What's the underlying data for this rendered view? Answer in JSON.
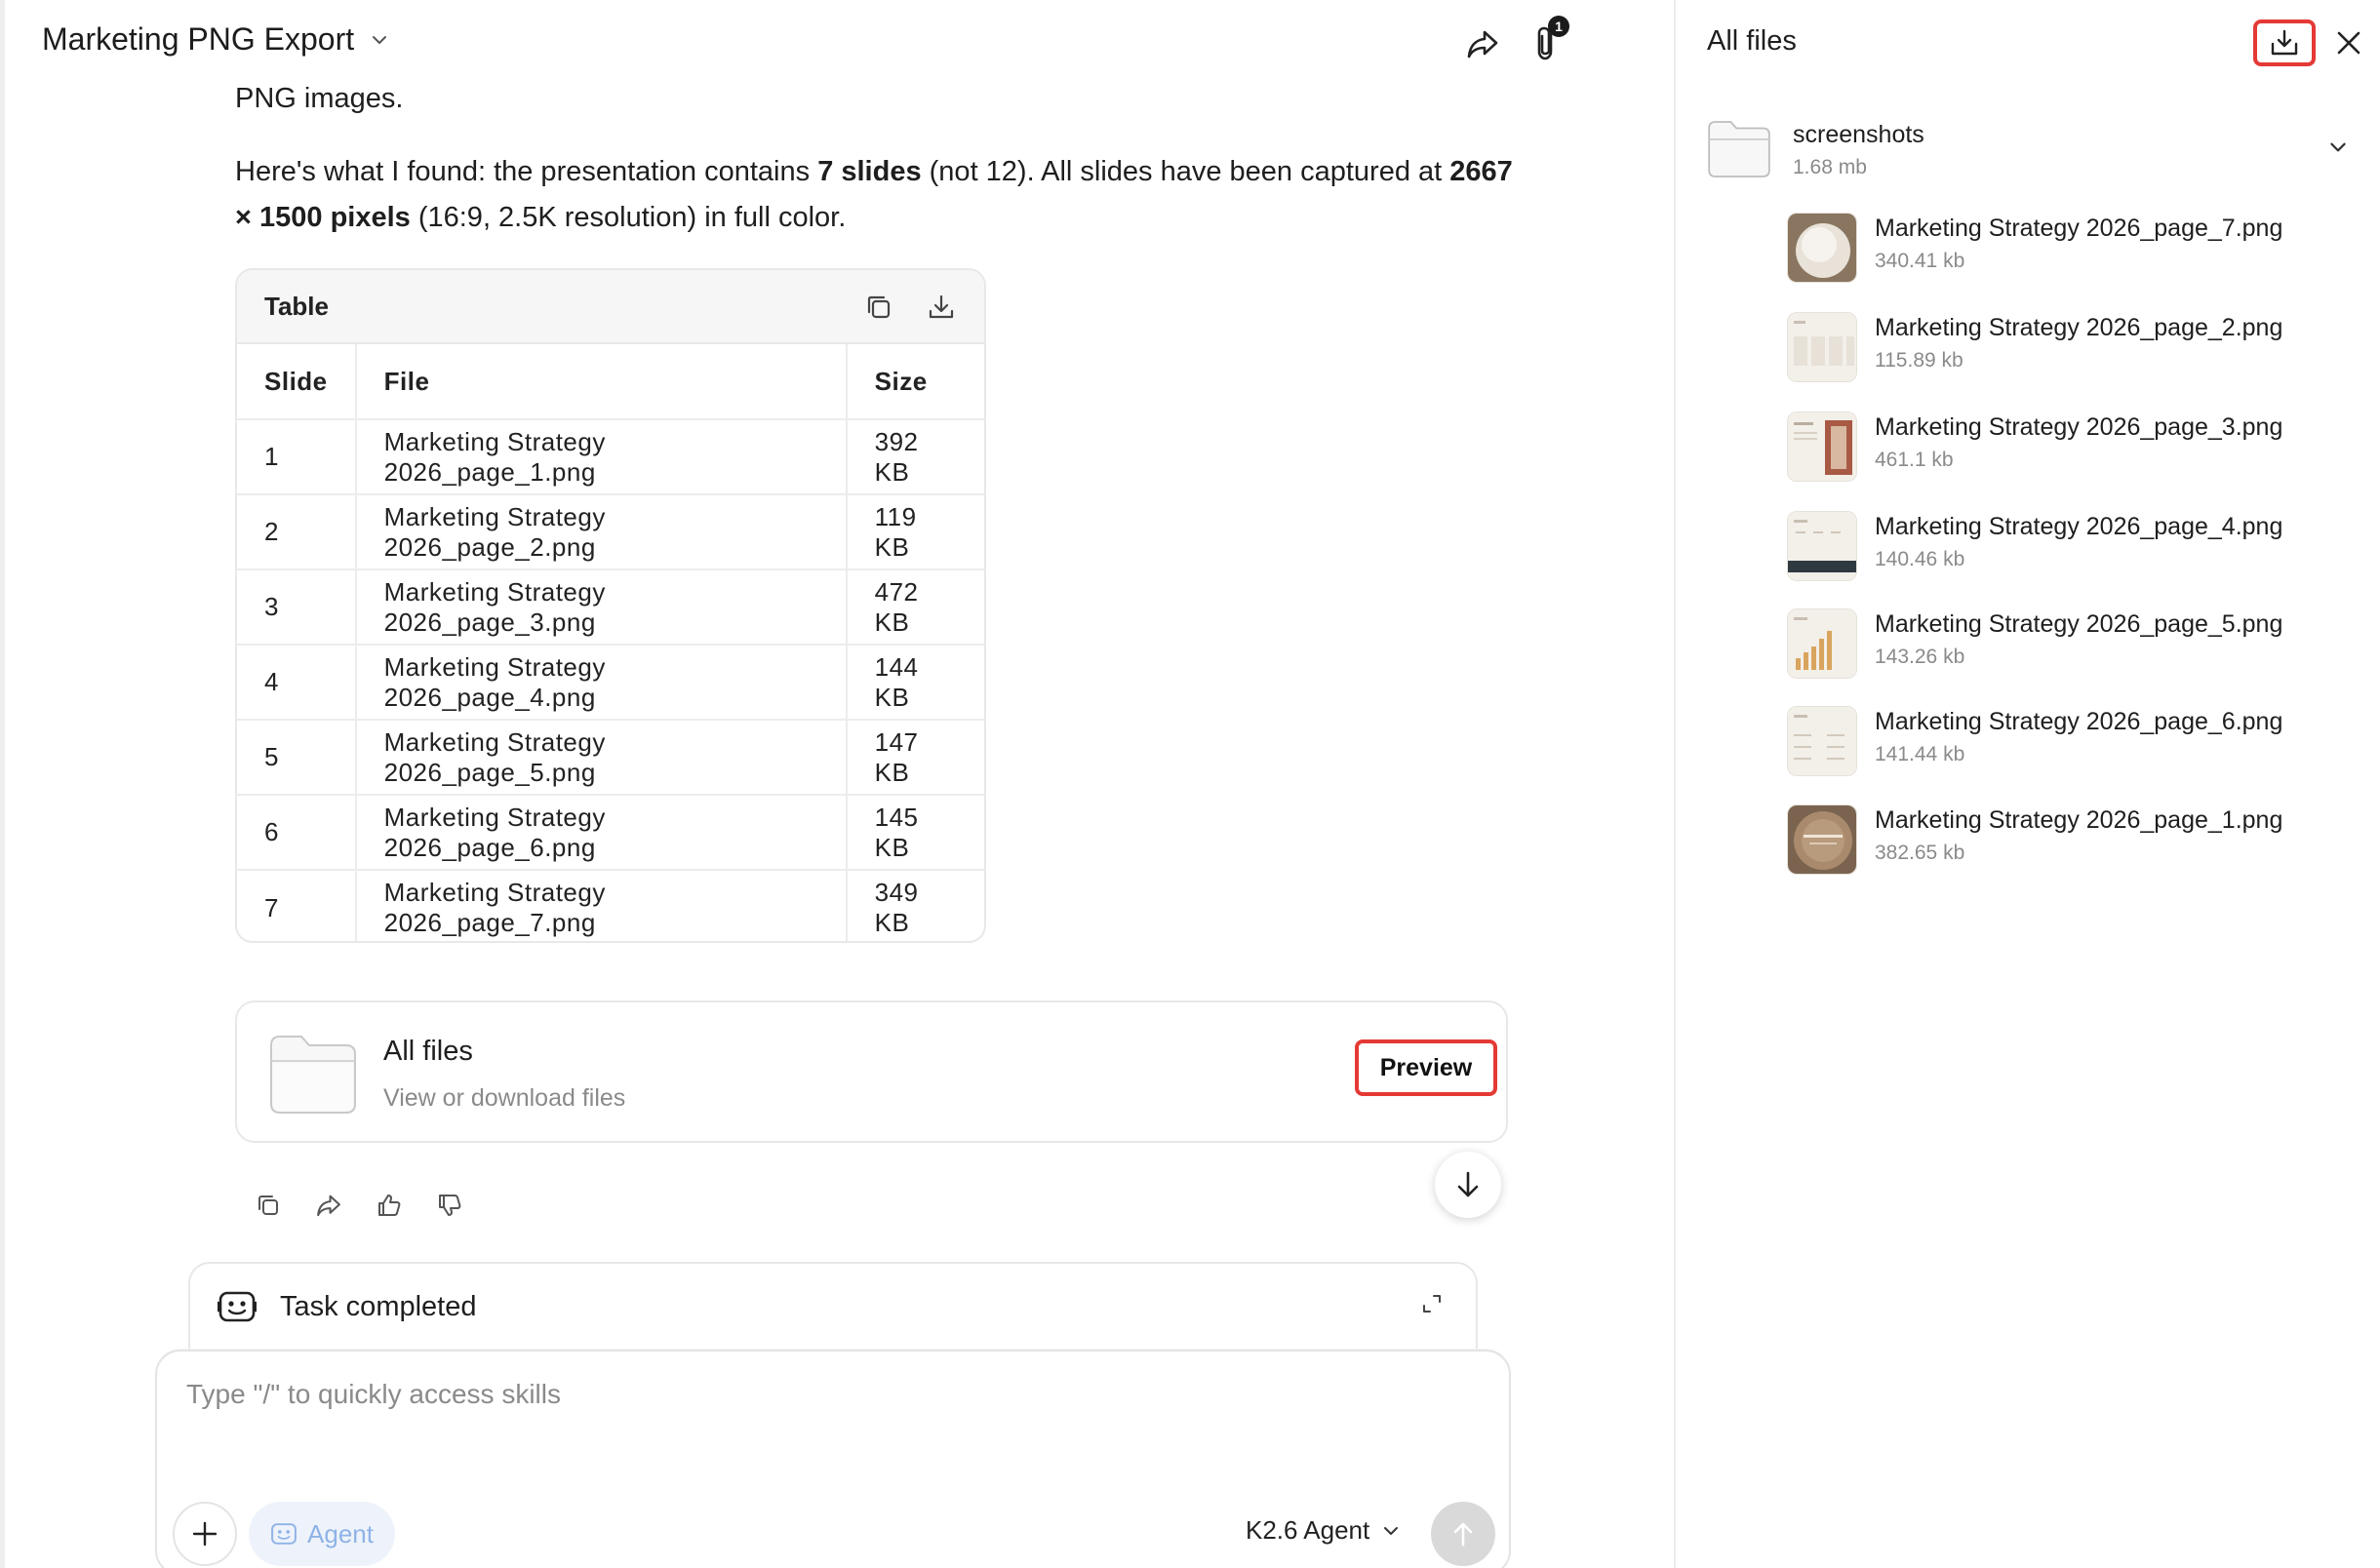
{
  "header": {
    "title": "Marketing PNG Export",
    "attach_count": "1"
  },
  "message": {
    "line0": "PNG images.",
    "p1_a": "Here's what I found: the presentation contains ",
    "p1_b": "7 slides",
    "p1_c": " (not 12). All slides have been captured at ",
    "p1_d": "2667",
    "p1_e": "× 1500 pixels",
    "p1_f": " (16:9, 2.5K resolution) in full color."
  },
  "table": {
    "title": "Table",
    "columns": [
      "Slide",
      "File",
      "Size"
    ],
    "rows": [
      [
        "1",
        "Marketing Strategy 2026_page_1.png",
        "392 KB"
      ],
      [
        "2",
        "Marketing Strategy 2026_page_2.png",
        "119 KB"
      ],
      [
        "3",
        "Marketing Strategy 2026_page_3.png",
        "472 KB"
      ],
      [
        "4",
        "Marketing Strategy 2026_page_4.png",
        "144 KB"
      ],
      [
        "5",
        "Marketing Strategy 2026_page_5.png",
        "147 KB"
      ],
      [
        "6",
        "Marketing Strategy 2026_page_6.png",
        "145 KB"
      ],
      [
        "7",
        "Marketing Strategy 2026_page_7.png",
        "349 KB"
      ]
    ]
  },
  "files_card": {
    "title": "All files",
    "subtitle": "View or download files",
    "preview_label": "Preview"
  },
  "task": {
    "label": "Task completed"
  },
  "composer": {
    "placeholder": "Type \"/\" to quickly access skills",
    "agent_label": "Agent",
    "model_label": "K2.6 Agent"
  },
  "panel": {
    "title": "All files",
    "folder": {
      "name": "screenshots",
      "size": "1.68 mb"
    },
    "files": [
      {
        "name": "Marketing Strategy 2026_page_7.png",
        "size": "340.41 kb",
        "thumb": "orb-light"
      },
      {
        "name": "Marketing Strategy 2026_page_2.png",
        "size": "115.89 kb",
        "thumb": "columns"
      },
      {
        "name": "Marketing Strategy 2026_page_3.png",
        "size": "461.1 kb",
        "thumb": "photo"
      },
      {
        "name": "Marketing Strategy 2026_page_4.png",
        "size": "140.46 kb",
        "thumb": "dark-band"
      },
      {
        "name": "Marketing Strategy 2026_page_5.png",
        "size": "143.26 kb",
        "thumb": "bars"
      },
      {
        "name": "Marketing Strategy 2026_page_6.png",
        "size": "141.44 kb",
        "thumb": "columns"
      },
      {
        "name": "Marketing Strategy 2026_page_1.png",
        "size": "382.65 kb",
        "thumb": "orb-dark"
      }
    ]
  },
  "colors": {
    "highlight": "#e53935",
    "muted_text": "#8a8a8a",
    "agent_chip": "#8fb3e6"
  }
}
